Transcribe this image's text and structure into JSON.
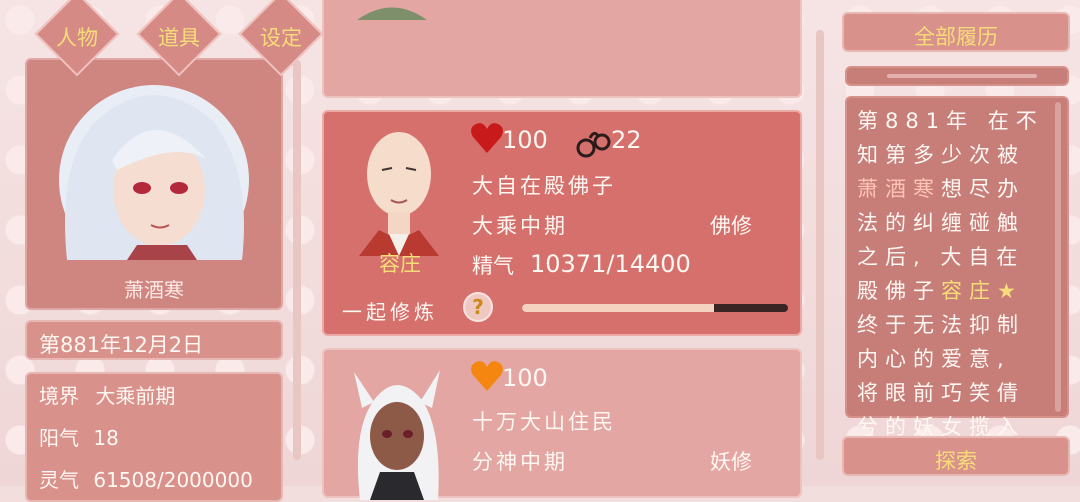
{
  "nav": {
    "items": [
      "人物",
      "道具",
      "设定",
      "榜单"
    ]
  },
  "player": {
    "name": "萧酒寒",
    "date": "第881年12月2日",
    "stats": [
      {
        "label": "境界",
        "value": "大乘前期"
      },
      {
        "label": "阳气",
        "value": "18"
      },
      {
        "label": "灵气",
        "value": "61508/2000000"
      }
    ]
  },
  "cards": [
    {
      "name": "容庄",
      "hp": "100",
      "cuffs": "22",
      "title": "大自在殿佛子",
      "realm": "大乘中期",
      "school": "佛修",
      "essence_label": "精气",
      "essence": "10371/14400",
      "essence_fraction": 0.72,
      "train_label": "一起修炼",
      "help_icon": "?"
    },
    {
      "hp": "100",
      "title": "十万大山住民",
      "realm": "分神中期",
      "school": "妖修"
    }
  ],
  "history": {
    "button": "全部履历",
    "text_parts": [
      {
        "t": "第881年 在不知第多少次被",
        "c": "normal"
      },
      {
        "t": "萧酒寒",
        "c": "pink"
      },
      {
        "t": "想尽办法的纠缠碰触之后, 大自在殿佛子",
        "c": "normal"
      },
      {
        "t": "容庄",
        "c": "gold"
      },
      {
        "t": "★",
        "c": "gold"
      },
      {
        "t": "终于无法抑制内心的爱意, 将眼前巧笑倩兮的妖女揽入了怀中",
        "c": "normal"
      }
    ]
  },
  "explore": {
    "label": "探索"
  },
  "colors": {
    "heart_red": "#c8191b",
    "heart_orange": "#f5860f",
    "accent_gold": "#f7dd7a",
    "panel": "#d9918c"
  }
}
